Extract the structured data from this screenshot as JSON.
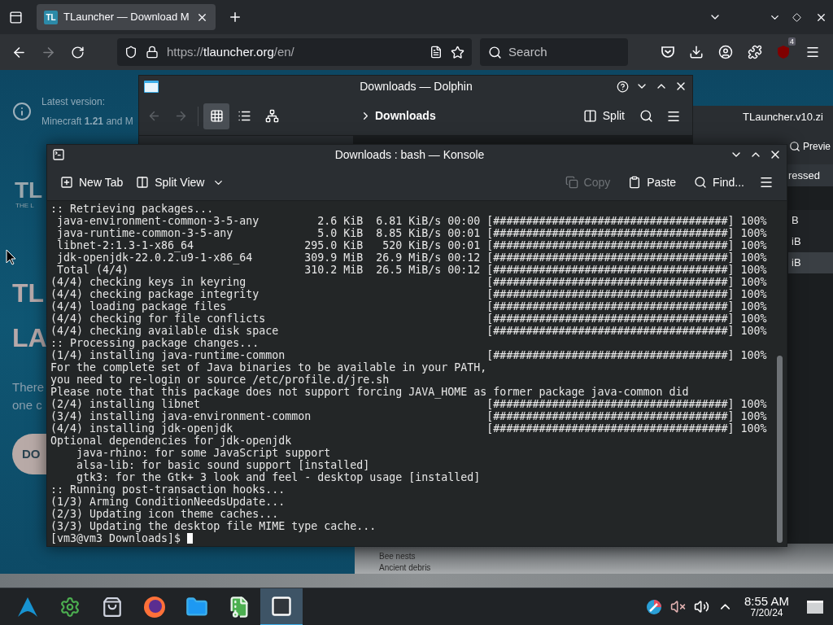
{
  "browser": {
    "tabs": [
      {
        "favicon": "TL",
        "title": "TLauncher — Download M",
        "selected": true
      }
    ],
    "url": {
      "scheme": "https://",
      "host": "tlauncher.org",
      "path": "/en/"
    },
    "search": {
      "placeholder": "Search"
    },
    "extension_badge": "4"
  },
  "web_page": {
    "notice_label": "Latest version:",
    "notice_text": "Minecraft **1.21** and M",
    "logo": "TL",
    "logo_tagline": "THE L",
    "heading_lines": [
      "TL",
      "LA"
    ],
    "paragraph_lines": [
      "There",
      "one c"
    ],
    "button": "DO"
  },
  "archive_window": {
    "title": "TLauncher.v10.zi",
    "preview_button": "Previe",
    "column_header": "ressed",
    "rows": [
      {
        "cell": "B",
        "selected": false
      },
      {
        "cell": "iB",
        "selected": false
      },
      {
        "cell": "iB",
        "selected": true
      }
    ],
    "preview_lines": [
      "Bee nests",
      "Ancient debris"
    ]
  },
  "dolphin": {
    "title": "Downloads — Dolphin",
    "views": [
      {
        "kind": "icons",
        "selected": true
      },
      {
        "kind": "details",
        "selected": false
      },
      {
        "kind": "tree",
        "selected": false
      }
    ],
    "breadcrumb": "Downloads",
    "split_button": "Split"
  },
  "konsole": {
    "title": "Downloads : bash — Konsole",
    "toolbar_left": [
      {
        "kind": "new-tab",
        "label": "New Tab",
        "disabled": false
      },
      {
        "kind": "split",
        "label": "Split View",
        "disabled": false
      }
    ],
    "toolbar_right": [
      {
        "kind": "copy",
        "label": "Copy",
        "disabled": true
      },
      {
        "kind": "paste",
        "label": "Paste",
        "disabled": false
      },
      {
        "kind": "find",
        "label": "Find...",
        "disabled": false
      }
    ],
    "lines": [
      ":: Retrieving packages...",
      " java-environment-common-3-5-any         2.6 KiB  6.81 KiB/s 00:00 [####################################] 100%",
      " java-runtime-common-3-5-any             5.0 KiB  8.85 KiB/s 00:01 [####################################] 100%",
      " libnet-2:1.3-1-x86_64                 295.0 KiB   520 KiB/s 00:01 [####################################] 100%",
      " jdk-openjdk-22.0.2.u9-1-x86_64        309.9 MiB  26.9 MiB/s 00:12 [####################################] 100%",
      " Total (4/4)                           310.2 MiB  26.5 MiB/s 00:12 [####################################] 100%",
      "(4/4) checking keys in keyring                                     [####################################] 100%",
      "(4/4) checking package integrity                                   [####################################] 100%",
      "(4/4) loading package files                                        [####################################] 100%",
      "(4/4) checking for file conflicts                                  [####################################] 100%",
      "(4/4) checking available disk space                                [####################################] 100%",
      ":: Processing package changes...",
      "(1/4) installing java-runtime-common                               [####################################] 100%",
      "For the complete set of Java binaries to be available in your PATH,",
      "you need to re-login or source /etc/profile.d/jre.sh",
      "Please note that this package does not support forcing JAVA_HOME as former package java-common did",
      "(2/4) installing libnet                                            [####################################] 100%",
      "(3/4) installing java-environment-common                           [####################################] 100%",
      "(4/4) installing jdk-openjdk                                       [####################################] 100%",
      "Optional dependencies for jdk-openjdk",
      "    java-rhino: for some JavaScript support",
      "    alsa-lib: for basic sound support [installed]",
      "    gtk3: for the Gtk+ 3 look and feel - desktop usage [installed]",
      ":: Running post-transaction hooks...",
      "(1/3) Arming ConditionNeedsUpdate...",
      "(2/3) Updating icon theme caches...",
      "(3/3) Updating the desktop file MIME type cache..."
    ],
    "prompt": "[vm3@vm3 Downloads]$"
  },
  "taskbar": {
    "apps": [
      {
        "kind": "launcher",
        "selected": false
      },
      {
        "kind": "settings",
        "selected": false
      },
      {
        "kind": "store",
        "selected": false
      },
      {
        "kind": "browser",
        "selected": false
      },
      {
        "kind": "files",
        "selected": false
      },
      {
        "kind": "archive",
        "selected": false
      },
      {
        "kind": "terminal",
        "selected": true
      }
    ],
    "tray": [
      {
        "kind": "color-picker"
      },
      {
        "kind": "muted-speaker"
      },
      {
        "kind": "volume"
      },
      {
        "kind": "expand"
      }
    ],
    "clock": {
      "time": "8:55 AM",
      "date": "7/20/24"
    }
  }
}
